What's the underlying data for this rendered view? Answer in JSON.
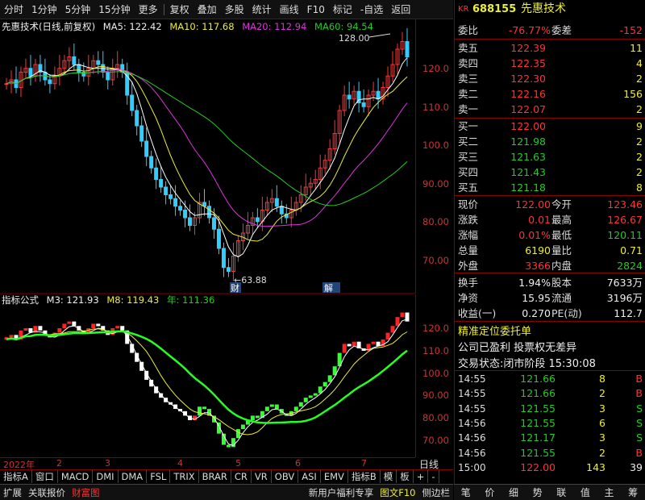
{
  "toolbar": [
    "分时",
    "1分钟",
    "5分钟",
    "15分钟",
    "更多",
    "复权",
    "叠加",
    "多股",
    "统计",
    "画线",
    "F10",
    "标记",
    "-自选",
    "返回"
  ],
  "kline_info": {
    "title": "先惠技术(日线,前复权)",
    "ma5": "MA5: 122.42",
    "ma10": "MA10: 117.68",
    "ma20": "MA20: 112.94",
    "ma60": "MA60: 94.54"
  },
  "price_axis": [
    "120.0",
    "110.0",
    "100.0",
    "90.00",
    "80.00",
    "70.00"
  ],
  "annotations": {
    "high": "128.00",
    "low": "63.88",
    "mark1": "财",
    "mark2": "解"
  },
  "indicator": {
    "name": "指标公式",
    "m3": "M3: 121.93",
    "m8": "M8: 119.43",
    "year": "年: 111.36"
  },
  "ind_axis": [
    "120.0",
    "110.0",
    "100.0",
    "90.00",
    "80.00",
    "70.00"
  ],
  "x_axis": [
    "2022年",
    "2",
    "3",
    "4",
    "5",
    "6",
    "7"
  ],
  "period_label": "日线",
  "tabs": [
    "指标A",
    "窗口",
    "MACD",
    "DMI",
    "DMA",
    "FSL",
    "TRIX",
    "BRAR",
    "CR",
    "VR",
    "OBV",
    "ASI",
    "EMV",
    "指标B",
    "模",
    "板",
    "+",
    "-"
  ],
  "status": {
    "items": [
      "扩展",
      "关联报价",
      "财富图"
    ],
    "right": [
      "新用户福利专享",
      "图文F10",
      "侧边栏"
    ]
  },
  "stock": {
    "market": "KR",
    "code": "688155",
    "name": "先惠技术"
  },
  "weibi": {
    "label": "委比",
    "value": "-76.77%",
    "label2": "委差",
    "value2": "-152"
  },
  "sells": [
    {
      "l": "卖五",
      "p": "122.39",
      "v": "11"
    },
    {
      "l": "卖四",
      "p": "122.35",
      "v": "4"
    },
    {
      "l": "卖三",
      "p": "122.30",
      "v": "2"
    },
    {
      "l": "卖二",
      "p": "122.16",
      "v": "156"
    },
    {
      "l": "卖一",
      "p": "122.07",
      "v": "2"
    }
  ],
  "buys": [
    {
      "l": "买一",
      "p": "122.00",
      "v": "9"
    },
    {
      "l": "买二",
      "p": "121.98",
      "v": "2"
    },
    {
      "l": "买三",
      "p": "121.63",
      "v": "2"
    },
    {
      "l": "买四",
      "p": "121.43",
      "v": "2"
    },
    {
      "l": "买五",
      "p": "121.18",
      "v": "8"
    }
  ],
  "quote": [
    {
      "l": "现价",
      "v": "122.00",
      "c": "red",
      "l2": "今开",
      "v2": "123.46",
      "c2": "red"
    },
    {
      "l": "涨跌",
      "v": "0.01",
      "c": "red",
      "l2": "最高",
      "v2": "126.67",
      "c2": "red"
    },
    {
      "l": "涨幅",
      "v": "0.01%",
      "c": "red",
      "l2": "最低",
      "v2": "120.11",
      "c2": "green"
    },
    {
      "l": "总量",
      "v": "6190",
      "c": "yel",
      "l2": "量比",
      "v2": "0.71",
      "c2": "yel"
    },
    {
      "l": "外盘",
      "v": "3366",
      "c": "red",
      "l2": "内盘",
      "v2": "2824",
      "c2": "green"
    }
  ],
  "fund": [
    {
      "l": "换手",
      "v": "1.94%",
      "l2": "股本",
      "v2": "7633万"
    },
    {
      "l": "净资",
      "v": "15.95",
      "l2": "流通",
      "v2": "3196万"
    },
    {
      "l": "收益(一)",
      "v": "0.270",
      "l2": "PE(动)",
      "v2": "112.7"
    }
  ],
  "notes": {
    "n1": "精准定位委托单",
    "n2": "公司已盈利 投票权无差异",
    "n3": "交易状态:闭市阶段 15:30:08"
  },
  "ticks": [
    {
      "t": "14:55",
      "p": "121.66",
      "v": "8",
      "d": "B"
    },
    {
      "t": "14:55",
      "p": "121.66",
      "v": "2",
      "d": "B"
    },
    {
      "t": "14:55",
      "p": "121.55",
      "v": "3",
      "d": "S"
    },
    {
      "t": "14:56",
      "p": "121.55",
      "v": "6",
      "d": "S"
    },
    {
      "t": "14:56",
      "p": "121.17",
      "v": "3",
      "d": "S"
    },
    {
      "t": "14:56",
      "p": "121.55",
      "v": "2",
      "d": "B"
    },
    {
      "t": "15:00",
      "p": "122.00",
      "v": "143",
      "d": "39"
    }
  ],
  "bottom_tabs": [
    "笔",
    "价",
    "细",
    "势",
    "联",
    "值",
    "主",
    "筹"
  ],
  "chart_data": {
    "type": "candlestick",
    "title": "先惠技术(日线,前复权)",
    "close_approx": [
      115,
      116,
      114,
      118,
      119,
      117,
      120,
      118,
      116,
      115,
      117,
      119,
      121,
      122,
      120,
      118,
      117,
      119,
      121,
      120,
      118,
      116,
      119,
      120,
      118,
      112,
      108,
      104,
      100,
      96,
      93,
      90,
      88,
      86,
      85,
      83,
      82,
      80,
      78,
      80,
      84,
      83,
      80,
      77,
      72,
      67,
      66,
      70,
      74,
      76,
      78,
      80,
      79,
      82,
      84,
      85,
      83,
      81,
      80,
      82,
      84,
      86,
      88,
      89,
      90,
      93,
      95,
      98,
      102,
      108,
      112,
      111,
      113,
      110,
      109,
      112,
      113,
      111,
      114,
      117,
      120,
      124,
      126,
      122
    ],
    "ylim": [
      63.88,
      128.0
    ]
  }
}
